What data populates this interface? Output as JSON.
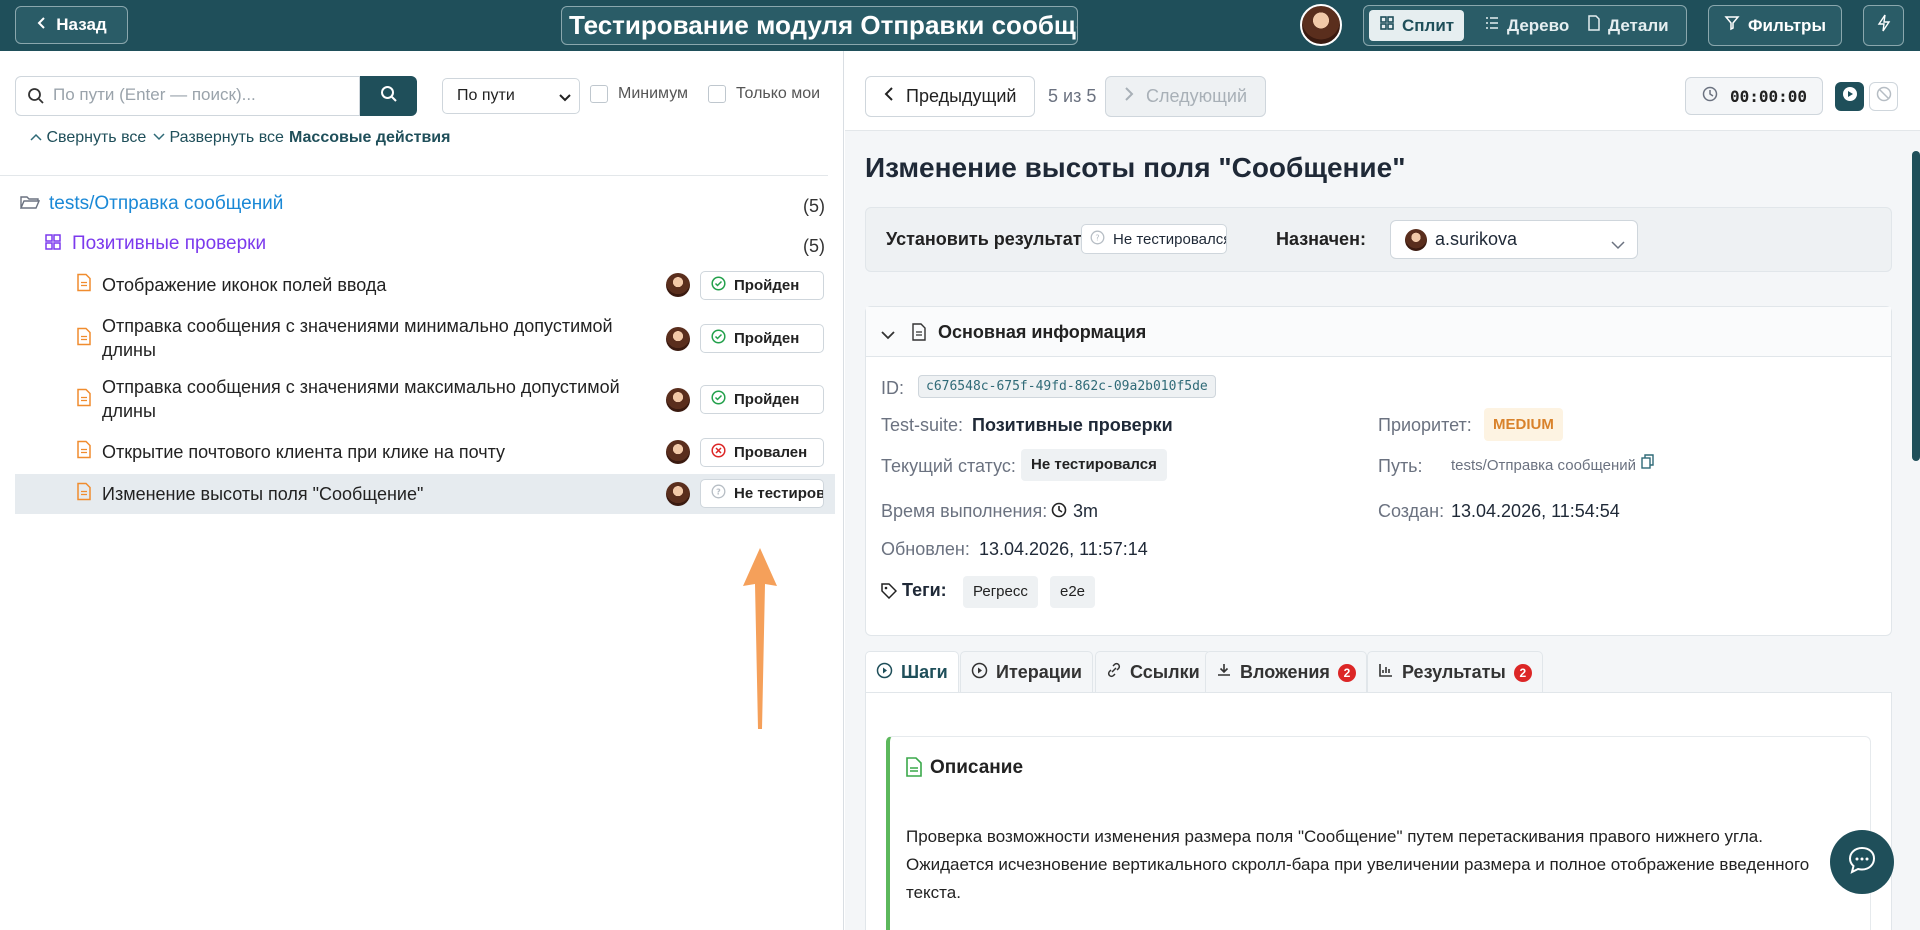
{
  "topbar": {
    "back_label": "Назад",
    "title": "Тестирование модуля Отправки сообще...",
    "views": [
      {
        "label": "Сплит",
        "active": true
      },
      {
        "label": "Дерево",
        "active": false
      },
      {
        "label": "Детали",
        "active": false
      }
    ],
    "filters_label": "Фильтры"
  },
  "left": {
    "search_placeholder": "По пути (Enter — поиск)...",
    "sort_value": "По пути",
    "minimum_label": "Минимум",
    "only_mine_label": "Только мои",
    "collapse_label": "Свернуть все",
    "expand_label": "Развернуть все",
    "bulk_label": "Массовые действия",
    "folder": {
      "name": "tests/Отправка сообщений",
      "count": "(5)"
    },
    "suite": {
      "name": "Позитивные проверки",
      "count": "(5)"
    },
    "cases": [
      {
        "name": "Отображение иконок полей ввода",
        "status": "Пройден",
        "state": "passed"
      },
      {
        "name": "Отправка сообщения с значениями минимально допустимой длины",
        "status": "Пройден",
        "state": "passed"
      },
      {
        "name": "Отправка сообщения с значениями максимально допустимой длины",
        "status": "Пройден",
        "state": "passed"
      },
      {
        "name": "Открытие почтового клиента при клике на почту",
        "status": "Провален",
        "state": "failed"
      },
      {
        "name": "Изменение высоты поля \"Сообщение\"",
        "status": "Не тестировался",
        "state": "untested",
        "selected": true
      }
    ]
  },
  "right": {
    "prev_label": "Предыдущий",
    "position": "5 из 5",
    "next_label": "Следующий",
    "timer": "00:00:00",
    "case_title": "Изменение высоты поля \"Сообщение\"",
    "set_result_label": "Установить результат:",
    "result_value": "Не тестировался",
    "assigned_label": "Назначен:",
    "assignee": "a.surikova",
    "info": {
      "section_title": "Основная информация",
      "id_label": "ID:",
      "id_value": "c676548c-675f-49fd-862c-09a2b010f5de",
      "suite_label": "Test-suite:",
      "suite_value": "Позитивные проверки",
      "priority_label": "Приоритет:",
      "priority_value": "MEDIUM",
      "status_label": "Текущий статус:",
      "status_value": "Не тестировался",
      "path_label": "Путь:",
      "path_value": "tests/Отправка сообщений",
      "duration_label": "Время выполнения:",
      "duration_value": "3m",
      "created_label": "Создан:",
      "created_value": "13.04.2026, 11:54:54",
      "updated_label": "Обновлен:",
      "updated_value": "13.04.2026, 11:57:14",
      "tags_label": "Теги:",
      "tags": [
        "Регресс",
        "e2e"
      ]
    },
    "tabs": [
      {
        "label": "Шаги",
        "active": true
      },
      {
        "label": "Итерации"
      },
      {
        "label": "Ссылки"
      },
      {
        "label": "Вложения",
        "count": "2"
      },
      {
        "label": "Результаты",
        "count": "2"
      }
    ],
    "description": {
      "title": "Описание",
      "line1": "Проверка возможности изменения размера поля \"Сообщение\" путем перетаскивания правого нижнего угла.",
      "line2": "Ожидается исчезновение вертикального скролл-бара при увеличении размера и полное отображение введенного",
      "line3": "текста."
    }
  },
  "colors": {
    "primary": "#1f4f5a",
    "passed": "#22a04b",
    "failed": "#dc2626",
    "folder": "#1a88d6",
    "suite": "#7c3aed",
    "annotation_arrow": "#f5a05a"
  }
}
